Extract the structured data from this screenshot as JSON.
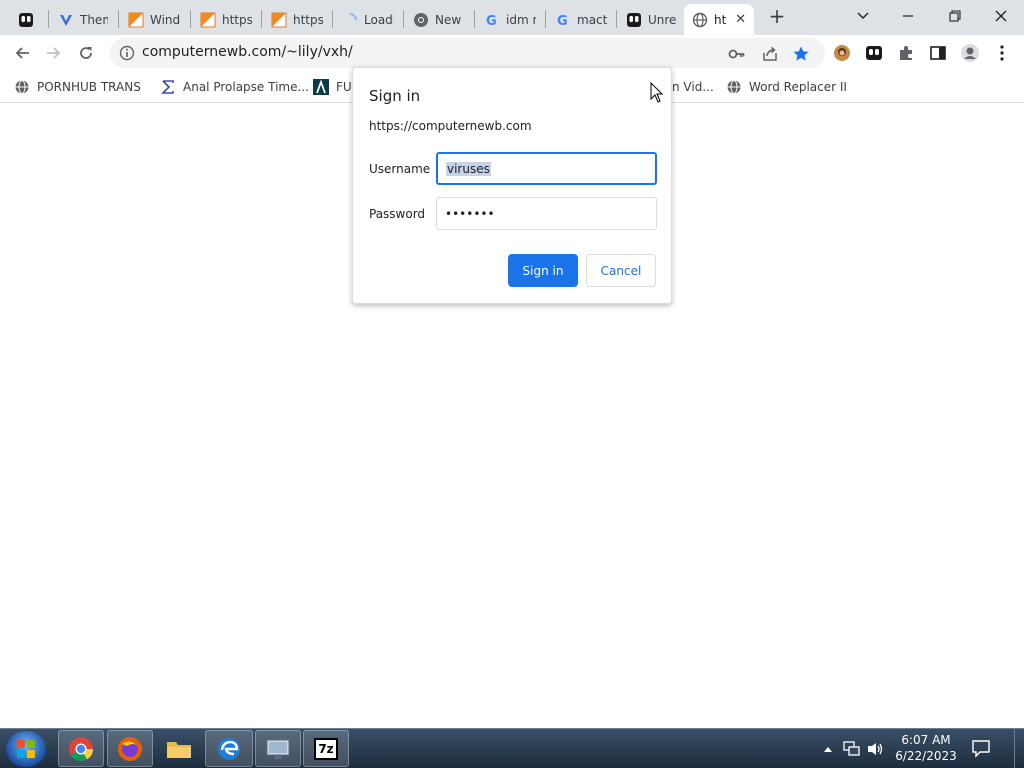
{
  "browser": {
    "tabs": [
      {
        "title": "",
        "icon": "tumblr-icon"
      },
      {
        "title": "Them",
        "icon": "vivaldi-icon"
      },
      {
        "title": "Wind",
        "icon": "orange-flag-icon"
      },
      {
        "title": "https",
        "icon": "orange-flag-icon"
      },
      {
        "title": "https",
        "icon": "orange-flag-icon"
      },
      {
        "title": "Loadi",
        "icon": "loading-icon"
      },
      {
        "title": "New",
        "icon": "chrome-icon"
      },
      {
        "title": "idm n",
        "icon": "google-icon"
      },
      {
        "title": "macty",
        "icon": "google-icon"
      },
      {
        "title": "Unrea",
        "icon": "tumblr-icon"
      },
      {
        "title": "ht",
        "icon": "globe-icon",
        "active": true
      }
    ],
    "new_tab_label": "+",
    "url": "computernewb.com/~lily/vxh/",
    "bookmarks": [
      {
        "label": "PORNHUB TRANS",
        "icon": "globe-icon"
      },
      {
        "label": "Anal Prolapse Time...",
        "icon": "sigma-icon"
      },
      {
        "label": "FU",
        "icon": "lambda-icon"
      },
      {
        "label": "n Vid...",
        "icon": ""
      },
      {
        "label": "Word Replacer II",
        "icon": "globe-icon"
      }
    ]
  },
  "dialog": {
    "title": "Sign in",
    "origin": "https://computernewb.com",
    "username_label": "Username",
    "username_value": "viruses",
    "password_label": "Password",
    "password_value": "•••••••",
    "sign_in_label": "Sign in",
    "cancel_label": "Cancel"
  },
  "taskbar": {
    "time": "6:07 AM",
    "date": "6/22/2023",
    "apps": [
      "chrome-icon",
      "firefox-icon",
      "explorer-folder-icon",
      "edge-icon",
      "control-panel-icon",
      "7zip-icon"
    ],
    "seven_zip_label": "7z"
  },
  "colors": {
    "accent": "#1a73e8",
    "tabstrip": "#dee1e6",
    "omnibox": "#f1f3f4",
    "selection": "#c6d3e9"
  }
}
